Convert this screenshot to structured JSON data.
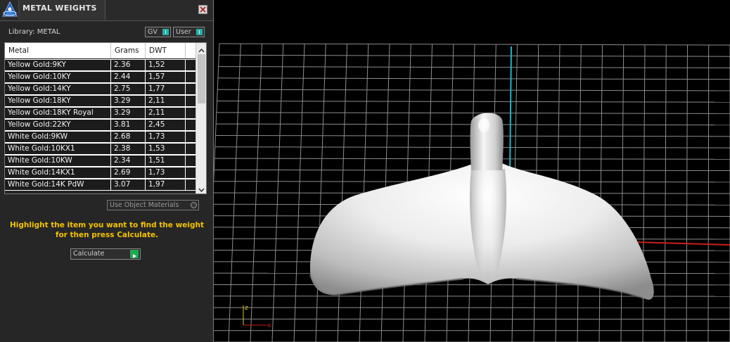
{
  "panel": {
    "title": "METAL WEIGHTS",
    "library_label": "Library: METAL",
    "toggles": [
      {
        "label": "GV"
      },
      {
        "label": "User"
      }
    ],
    "table": {
      "columns": [
        "Metal",
        "Grams",
        "DWT"
      ],
      "rows": [
        [
          "Yellow Gold:9KY",
          "2.36",
          "1,52"
        ],
        [
          "Yellow Gold:10KY",
          "2.44",
          "1,57"
        ],
        [
          "Yellow Gold:14KY",
          "2.75",
          "1,77"
        ],
        [
          "Yellow Gold:18KY",
          "3.29",
          "2,11"
        ],
        [
          "Yellow Gold:18KY Royal",
          "3.29",
          "2,11"
        ],
        [
          "Yellow Gold:22KY",
          "3.81",
          "2,45"
        ],
        [
          "White Gold:9KW",
          "2.68",
          "1,73"
        ],
        [
          "White Gold:10KX1",
          "2.38",
          "1,53"
        ],
        [
          "White Gold:10KW",
          "2.34",
          "1,51"
        ],
        [
          "White Gold:14KX1",
          "2.69",
          "1,73"
        ],
        [
          "White Gold:14K PdW",
          "3.07",
          "1,97"
        ]
      ]
    },
    "use_object_materials": "Use Object Materials",
    "hint_line1": "Highlight the item you want to find the weight",
    "hint_line2": "for then press Calculate.",
    "calculate_label": "Calculate",
    "accent_color": "#26b0a8",
    "hint_color": "#f2c200",
    "calculate_indicator_color": "#1faa55"
  },
  "viewport": {
    "background": "#000000",
    "grid_color": "#8c8c8c",
    "y_axis_color": "#1fb5c4",
    "x_axis_color": "#c81e1e",
    "gizmo_labels": {
      "z": "z",
      "x": "x"
    }
  }
}
